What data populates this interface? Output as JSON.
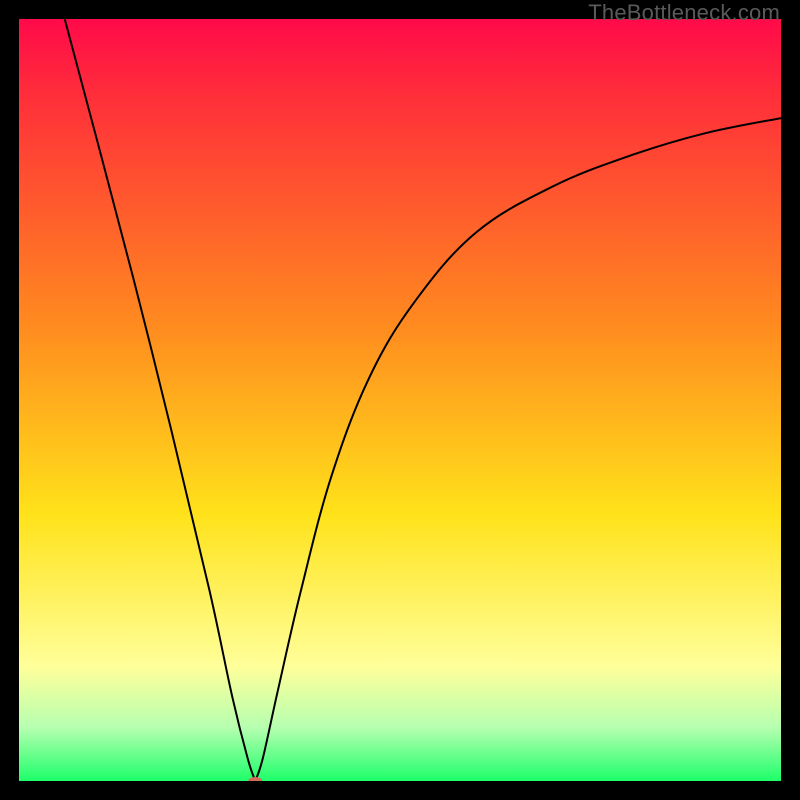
{
  "watermark": "TheBottleneck.com",
  "colors": {
    "red_top": "#ff0a4a",
    "red": "#ff2e3a",
    "orange": "#ff8a1f",
    "yellow": "#ffe21a",
    "pale_yellow": "#ffff9a",
    "pale_green": "#b6ffb0",
    "green": "#1dff6a",
    "black": "#000000",
    "marker": "#d46a5a"
  },
  "chart_data": {
    "type": "line",
    "title": "",
    "xlabel": "",
    "ylabel": "",
    "xlim": [
      0,
      100
    ],
    "ylim": [
      0,
      100
    ],
    "notch_x": 31,
    "marker": {
      "x": 31,
      "y": 0,
      "rx": 7,
      "ry": 4
    },
    "left_curve": {
      "name": "left-branch",
      "points": [
        {
          "x": 6,
          "y": 100
        },
        {
          "x": 10,
          "y": 85
        },
        {
          "x": 15,
          "y": 66
        },
        {
          "x": 20,
          "y": 46
        },
        {
          "x": 25,
          "y": 25
        },
        {
          "x": 28,
          "y": 11
        },
        {
          "x": 30,
          "y": 3
        },
        {
          "x": 31,
          "y": 0
        }
      ]
    },
    "right_curve": {
      "name": "right-branch",
      "points": [
        {
          "x": 31,
          "y": 0
        },
        {
          "x": 32,
          "y": 3
        },
        {
          "x": 34,
          "y": 12
        },
        {
          "x": 37,
          "y": 25
        },
        {
          "x": 41,
          "y": 40
        },
        {
          "x": 46,
          "y": 53
        },
        {
          "x": 52,
          "y": 63
        },
        {
          "x": 60,
          "y": 72
        },
        {
          "x": 70,
          "y": 78
        },
        {
          "x": 80,
          "y": 82
        },
        {
          "x": 90,
          "y": 85
        },
        {
          "x": 100,
          "y": 87
        }
      ]
    },
    "gradient_stops": [
      {
        "offset": 0,
        "key": "red_top"
      },
      {
        "offset": 0.1,
        "key": "red"
      },
      {
        "offset": 0.4,
        "key": "orange"
      },
      {
        "offset": 0.65,
        "key": "yellow"
      },
      {
        "offset": 0.85,
        "key": "pale_yellow"
      },
      {
        "offset": 0.93,
        "key": "pale_green"
      },
      {
        "offset": 1.0,
        "key": "green"
      }
    ]
  }
}
